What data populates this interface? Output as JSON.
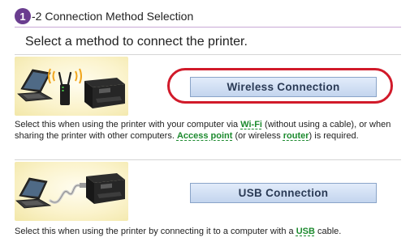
{
  "step": {
    "number": "1",
    "title": "-2 Connection Method Selection"
  },
  "subtitle": "Select a method to connect the printer.",
  "wireless": {
    "button_label": "Wireless Connection",
    "desc_part1": "Select this when using the printer with your computer via ",
    "term_wifi": "Wi-Fi",
    "desc_part2": " (without using a cable), or when sharing the printer with other computers. ",
    "term_access_point": "Access point",
    "desc_part3": " (or wireless ",
    "term_router": "router",
    "desc_part4": ") is required."
  },
  "usb": {
    "button_label": "USB Connection",
    "desc_part1": "Select this when using the printer by connecting it to a computer with a ",
    "term_usb": "USB",
    "desc_part2": " cable."
  },
  "colors": {
    "step_badge": "#6a3d8f",
    "highlight_ring": "#d11a2a",
    "glossary_term": "#1c8a2e",
    "button_bg": "#c3d5ee"
  },
  "icons": [
    "laptop-icon",
    "wireless-router-icon",
    "printer-icon",
    "usb-cable-icon"
  ]
}
